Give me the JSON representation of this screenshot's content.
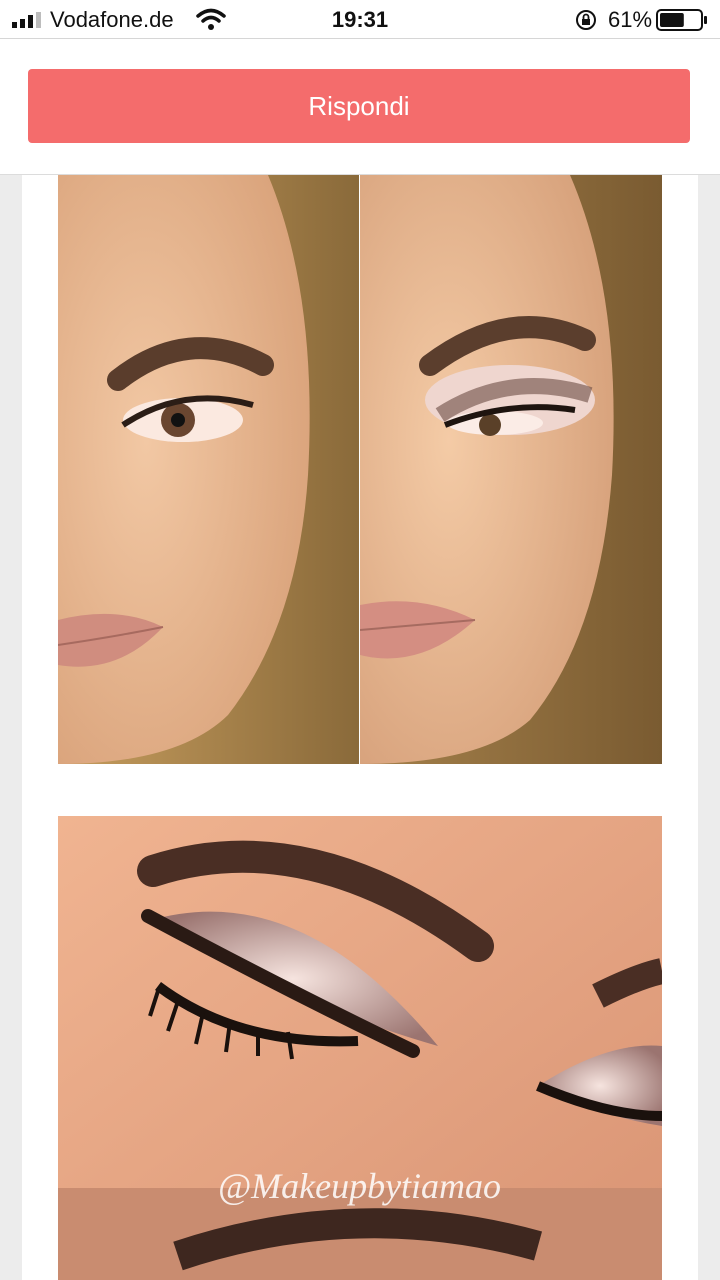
{
  "status_bar": {
    "carrier": "Vodafone.de",
    "time": "19:31",
    "battery_percent": "61%",
    "battery_level": 0.61,
    "icons": [
      "signal-icon",
      "wifi-icon",
      "rotation-lock-icon",
      "battery-icon"
    ]
  },
  "reply": {
    "button_label": "Rispondi",
    "button_color": "#f46c6c"
  },
  "post": {
    "images": [
      {
        "name": "makeup-before-photo"
      },
      {
        "name": "makeup-after-photo"
      },
      {
        "name": "eye-makeup-closeup-photo"
      }
    ],
    "watermark": "@Makeupbytiamao"
  }
}
